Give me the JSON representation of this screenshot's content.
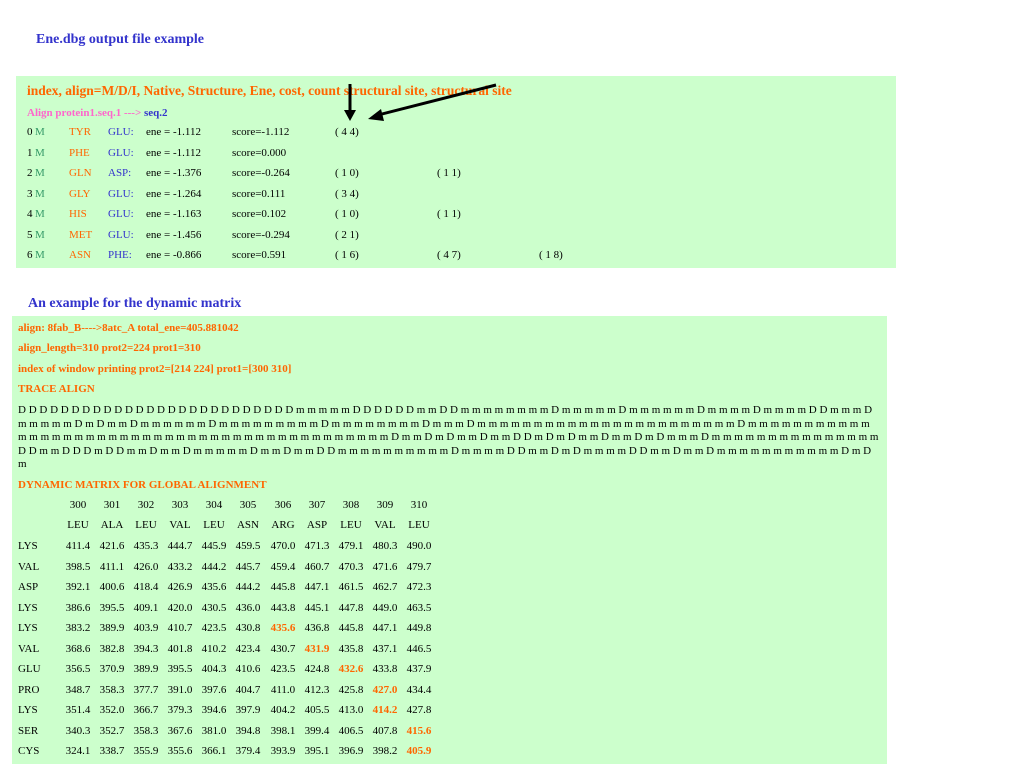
{
  "page_title": "Ene.dbg output file example",
  "dbg": {
    "header": "index, align=M/D/I, Native, Structure, Ene, cost, count structural site, structural site",
    "align_prefix": "Align protein1.seq.1 --->",
    "align_target": "seq.2",
    "rows": [
      {
        "idx": "0",
        "op": "M",
        "native": "TYR",
        "struct": "GLU:",
        "ene": "ene = -1.112",
        "score": "score=-1.112",
        "s1": "( 4  4)",
        "s2": "",
        "s3": ""
      },
      {
        "idx": "1",
        "op": "M",
        "native": "PHE",
        "struct": "GLU:",
        "ene": "ene = -1.112",
        "score": "score=0.000",
        "s1": "",
        "s2": "",
        "s3": ""
      },
      {
        "idx": "2",
        "op": "M",
        "native": "GLN",
        "struct": "ASP:",
        "ene": "ene = -1.376",
        "score": "score=-0.264",
        "s1": "( 1  0)",
        "s2": "( 1  1)",
        "s3": ""
      },
      {
        "idx": "3",
        "op": "M",
        "native": "GLY",
        "struct": "GLU:",
        "ene": "ene = -1.264",
        "score": "score=0.111",
        "s1": "( 3  4)",
        "s2": "",
        "s3": ""
      },
      {
        "idx": "4",
        "op": "M",
        "native": "HIS",
        "struct": "GLU:",
        "ene": "ene = -1.163",
        "score": "score=0.102",
        "s1": "( 1  0)",
        "s2": "( 1  1)",
        "s3": ""
      },
      {
        "idx": "5",
        "op": "M",
        "native": "MET",
        "struct": "GLU:",
        "ene": "ene = -1.456",
        "score": "score=-0.294",
        "s1": "( 2  1)",
        "s2": "",
        "s3": ""
      },
      {
        "idx": "6",
        "op": "M",
        "native": "ASN",
        "struct": "PHE:",
        "ene": "ene = -0.866",
        "score": "score=0.591",
        "s1": "( 1  6)",
        "s2": "( 4  7)",
        "s3": "( 1  8)"
      }
    ]
  },
  "dyn_title": "An example for the dynamic matrix",
  "dyn": {
    "align_line": "align: 8fab_B---->8atc_A     total_ene=405.881042",
    "length_line": "align_length=310        prot2=224                   prot1=310",
    "window_line": "index of window printing prot2=[214 224] prot1=[300 310]",
    "trace_heading": "TRACE ALIGN",
    "trace_text": "D D D D D D D D D D D D D D D D D D D D D D D D D D m m m m m D D D D D D m m D D m m m m m m m m D m m m m m D m m m m m m D m m m m D m m m m D D m m m D m m m m m D m D m m D m m m m m m D m m m m m m m m m D m m m m m m m m D m m m D m m m m m m m m m m m m m m m m m m m m m m m D m m m m m m m m m m m m m m m m m m m m m m m m m m m m m m m m m m m m m m m m m m m m D m m D m D m m D m m D D m D m D m m D m m D m D m m m D m m m m m m m m m m m m m m m D D m m D D D m D D m m D m m D m m m m m D m m D m m D D m m m m m m m m m m D m m m m D D m m D m D m m m m D D m m D m m D m m m m m m m m m m m D m D m",
    "matrix_heading": "DYNAMIC MATRIX FOR GLOBAL ALIGNMENT",
    "col_nums": [
      "300",
      "301",
      "302",
      "303",
      "304",
      "305",
      "306",
      "307",
      "308",
      "309",
      "310"
    ],
    "col_res": [
      "LEU",
      "ALA",
      "LEU",
      "VAL",
      "LEU",
      "ASN",
      "ARG",
      "ASP",
      "LEU",
      "VAL",
      "LEU"
    ],
    "rows": [
      {
        "label": "LYS",
        "vals": [
          "411.4",
          "421.6",
          "435.3",
          "444.7",
          "445.9",
          "459.5",
          "470.0",
          "471.3",
          "479.1",
          "480.3",
          "490.0"
        ],
        "hl": -1
      },
      {
        "label": "VAL",
        "vals": [
          "398.5",
          "411.1",
          "426.0",
          "433.2",
          "444.2",
          "445.7",
          "459.4",
          "460.7",
          "470.3",
          "471.6",
          "479.7"
        ],
        "hl": -1
      },
      {
        "label": "ASP",
        "vals": [
          "392.1",
          "400.6",
          "418.4",
          "426.9",
          "435.6",
          "444.2",
          "445.8",
          "447.1",
          "461.5",
          "462.7",
          "472.3"
        ],
        "hl": -1
      },
      {
        "label": "LYS",
        "vals": [
          "386.6",
          "395.5",
          "409.1",
          "420.0",
          "430.5",
          "436.0",
          "443.8",
          "445.1",
          "447.8",
          "449.0",
          "463.5"
        ],
        "hl": -1
      },
      {
        "label": "LYS",
        "vals": [
          "383.2",
          "389.9",
          "403.9",
          "410.7",
          "423.5",
          "430.8",
          "435.6",
          "436.8",
          "445.8",
          "447.1",
          "449.8"
        ],
        "hl": 6
      },
      {
        "label": "VAL",
        "vals": [
          "368.6",
          "382.8",
          "394.3",
          "401.8",
          "410.2",
          "423.4",
          "430.7",
          "431.9",
          "435.8",
          "437.1",
          "446.5"
        ],
        "hl": 7
      },
      {
        "label": "GLU",
        "vals": [
          "356.5",
          "370.9",
          "389.9",
          "395.5",
          "404.3",
          "410.6",
          "423.5",
          "424.8",
          "432.6",
          "433.8",
          "437.9"
        ],
        "hl": 8
      },
      {
        "label": "PRO",
        "vals": [
          "348.7",
          "358.3",
          "377.7",
          "391.0",
          "397.6",
          "404.7",
          "411.0",
          "412.3",
          "425.8",
          "427.0",
          "434.4"
        ],
        "hl": 9
      },
      {
        "label": "LYS",
        "vals": [
          "351.4",
          "352.0",
          "366.7",
          "379.3",
          "394.6",
          "397.9",
          "404.2",
          "405.5",
          "413.0",
          "414.2",
          "427.8"
        ],
        "hl": 9
      },
      {
        "label": "SER",
        "vals": [
          "340.3",
          "352.7",
          "358.3",
          "367.6",
          "381.0",
          "394.8",
          "398.1",
          "399.4",
          "406.5",
          "407.8",
          "415.6"
        ],
        "hl": 10
      },
      {
        "label": "CYS",
        "vals": [
          "324.1",
          "338.7",
          "355.9",
          "355.6",
          "366.1",
          "379.4",
          "393.9",
          "395.1",
          "396.9",
          "398.2",
          "405.9"
        ],
        "hl": 10
      }
    ]
  },
  "colors": {
    "highlight": "#ff6600",
    "panel_bg": "#ccffcc",
    "title_blue": "#3333cc"
  }
}
